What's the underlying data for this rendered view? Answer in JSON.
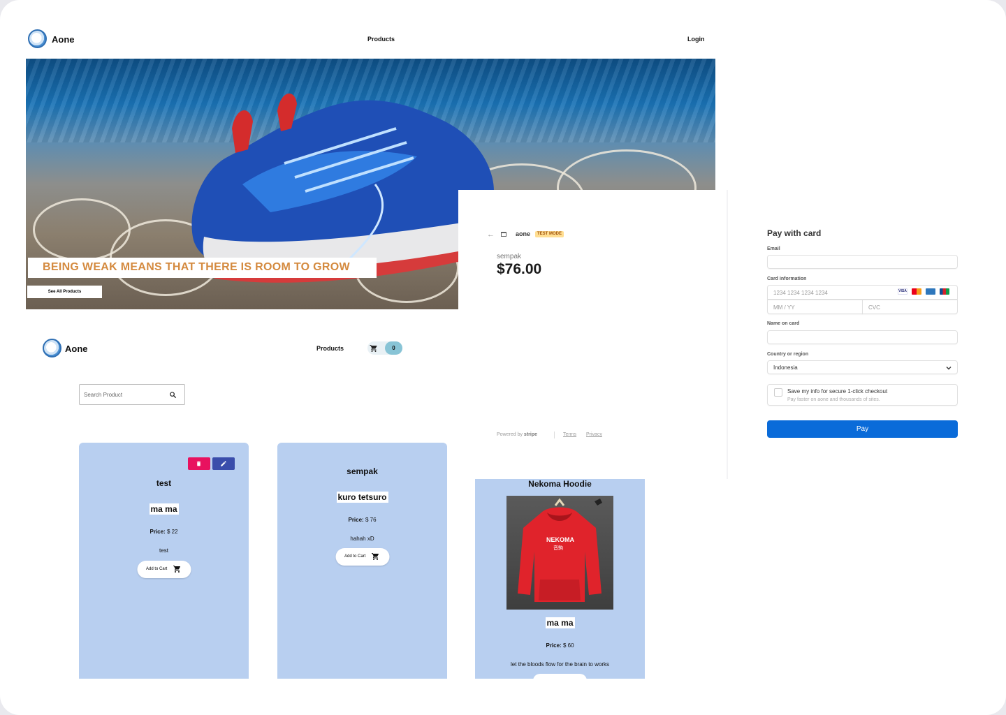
{
  "nav": {
    "brand": "Aone",
    "products": "Products",
    "login": "Login"
  },
  "hero": {
    "tagline": "BEING WEAK MEANS THAT THERE IS ROOM TO GROW",
    "cta": "See All Products"
  },
  "checkout": {
    "back_icon": "arrow-left-icon",
    "store_name": "aone",
    "mode_badge": "TEST MODE",
    "product_name": "sempak",
    "price": "$76.00",
    "powered_prefix": "Powered by",
    "powered_brand": "stripe",
    "terms": "Terms",
    "privacy": "Privacy",
    "pay_title": "Pay with card",
    "email_label": "Email",
    "card_label": "Card information",
    "card_number_ph": "1234 1234 1234 1234",
    "expiry_ph": "MM / YY",
    "cvc_ph": "CVC",
    "name_label": "Name on card",
    "country_label": "Country or region",
    "country_value": "Indonesia",
    "save_info": "Save my info for secure 1-click checkout",
    "save_info_sub": "Pay faster on aone and thousands of sites.",
    "pay_button": "Pay",
    "card_brands": [
      "VISA",
      "Mastercard",
      "Amex",
      "JCB"
    ]
  },
  "shop_nav": {
    "brand": "Aone",
    "products": "Products",
    "cart_count": "0"
  },
  "search": {
    "placeholder": "Search Product"
  },
  "products": [
    {
      "title": "test",
      "name": "ma ma",
      "price_label": "Price:",
      "price": " $ 22",
      "desc": "test",
      "add_to_cart": "Add to Cart"
    },
    {
      "title": "sempak",
      "name": "kuro tetsuro",
      "price_label": "Price:",
      "price": " $ 76",
      "desc": "hahah xD",
      "add_to_cart": "Add to Cart"
    },
    {
      "title": "Nekoma Hoodie",
      "name": "ma ma",
      "price_label": "Price:",
      "price": " $ 60",
      "desc": "let the bloods flow for the brain to works",
      "hoodie_print": "NEKOMA",
      "hoodie_sub": "音駒"
    }
  ],
  "colors": {
    "card_bg": "#b8cff0",
    "delete": "#e8125f",
    "edit": "#3a4dab",
    "pay": "#0a6bd9",
    "tagline": "#d48a3f",
    "badge": "#ffde92",
    "cart_count": "#88c4d6"
  }
}
